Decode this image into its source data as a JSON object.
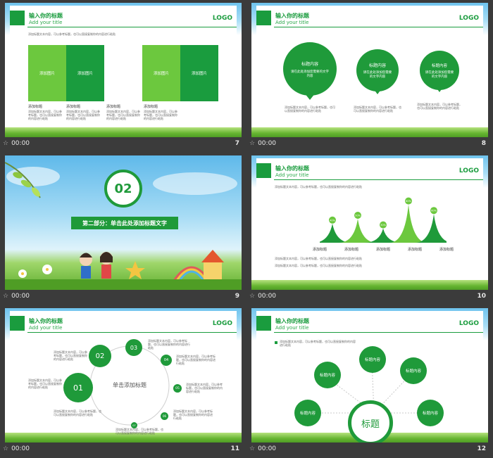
{
  "header": {
    "title": "输入你的标题",
    "subtitle": "Add your title",
    "logo": "LOGO"
  },
  "time": "00:00",
  "lorem": "添加标题文本内容，可以参考标题，也可以直接复制你的内容进行粘贴",
  "slide7": {
    "number": "7",
    "boxes": [
      "添加图片",
      "添加图片",
      "添加图片",
      "添加图片"
    ],
    "col_titles": [
      "添加标题",
      "添加标题",
      "添加标题",
      "添加标题"
    ]
  },
  "slide8": {
    "number": "8",
    "circles": [
      {
        "title": "标题内容",
        "body": "请在此处添加您需要的文字内容"
      },
      {
        "title": "标题内容",
        "body": "请在此处添加您需要的文字内容"
      },
      {
        "title": "标题内容",
        "body": "请在此处添加您需要的文字内容"
      }
    ]
  },
  "slide9": {
    "number": "9",
    "section_num": "02",
    "section_title": "第二部分：单击此处添加标题文字"
  },
  "slide10": {
    "number": "10",
    "labels": [
      "添加标题",
      "添加标题",
      "添加标题",
      "添加标题",
      "添加标题"
    ],
    "peaks": [
      {
        "name": "",
        "value": 40
      },
      {
        "name": "",
        "value": 50
      },
      {
        "name": "",
        "value": 30
      },
      {
        "name": "",
        "value": 80
      },
      {
        "name": "",
        "value": 60
      }
    ]
  },
  "slide11": {
    "number": "11",
    "center": "单击添加标题",
    "nodes": [
      "01",
      "02",
      "03",
      "04",
      "05",
      "06",
      "07"
    ]
  },
  "slide12": {
    "number": "12",
    "center": "标题",
    "nodes": [
      "标题内容",
      "标题内容",
      "标题内容",
      "标题内容",
      "标题内容"
    ]
  }
}
